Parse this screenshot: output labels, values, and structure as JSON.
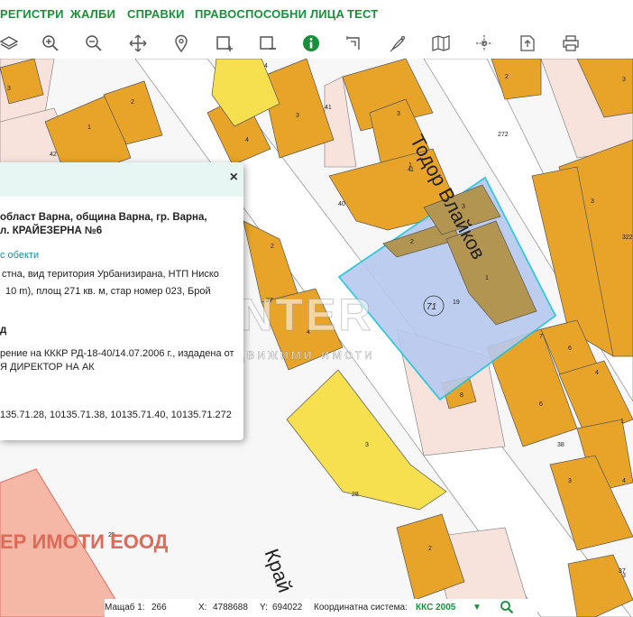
{
  "menu": {
    "items": [
      "РЕГИСТРИ",
      "ЖАЛБИ",
      "СПРАВКИ",
      "ПРАВОСПОСОБНИ ЛИЦА",
      "ТЕСТ"
    ]
  },
  "toolbar": {
    "icons": [
      "layers-icon",
      "zoom-in-icon",
      "zoom-out-icon",
      "pan-icon",
      "location-pin-icon",
      "add-area-icon",
      "remove-area-icon",
      "info-icon",
      "measure-icon",
      "pen-icon",
      "map-icon",
      "crosshair-icon",
      "upload-icon",
      "print-icon"
    ]
  },
  "popup": {
    "address_line1": "област Варна, община Варна, гр. Варна,",
    "address_line2": "л. КРАЙЕЗЕРНА №6",
    "related_link": "с обекти",
    "desc_line1": "стна, вид територия Урбанизирана, НТП Ниско",
    "desc_line2": "10 m), площ 271 кв. м, стар номер 023, Брой",
    "section_label": "д",
    "order_line1": "рение на КККР РД-18-40/14.07.2006 г., издадена от",
    "order_line2": "Я ДИРЕКТОР НА АК",
    "neighbors": "135.71.28, 10135.71.38, 10135.71.40, 10135.71.272",
    "close": "×"
  },
  "map": {
    "street_todor": "Тодор Влайков",
    "street_kray": "Край",
    "company_banner": "ЕР ИМОТИ ЕООД",
    "watermark": "ENTER",
    "watermark_sub": "недвижими имоти",
    "parcel_number": "71",
    "colors": {
      "building": "#e8a428",
      "selected": "#b7c9f0",
      "highlight": "#f7e050",
      "parcel_border": "#22c3d8",
      "selected_building": "#b39552"
    }
  },
  "status": {
    "scale_label": "Мащаб 1:",
    "scale_value": "266",
    "x_label": "X:",
    "x_value": "4788688",
    "y_label": "Y:",
    "y_value": "694022",
    "crs_label": "Координатна система:",
    "crs_value": "ККС 2005"
  }
}
